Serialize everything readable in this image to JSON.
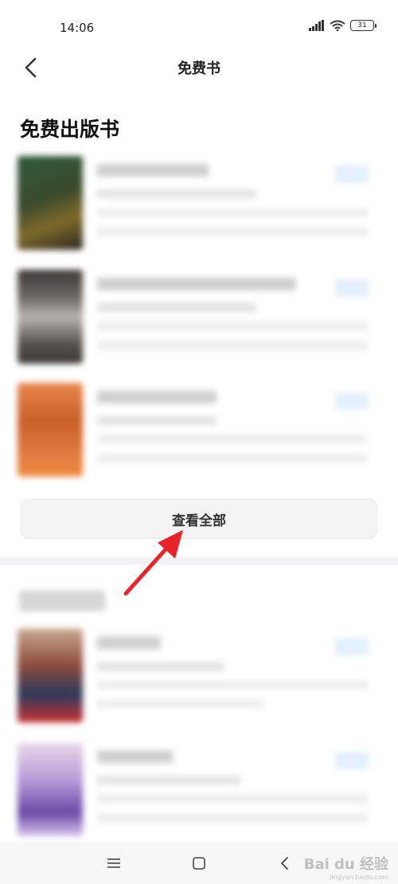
{
  "status_bar": {
    "time": "14:06",
    "battery": "31"
  },
  "nav": {
    "title": "免费书"
  },
  "section1": {
    "title": "免费出版书",
    "books": [
      {
        "cover_color": "#3a4a2a",
        "cover_accent": "#7d6a2a"
      },
      {
        "cover_color": "#4a4643",
        "cover_accent": "#a8a39e"
      },
      {
        "cover_color": "#e07a3f",
        "cover_accent": "#c85f28"
      }
    ],
    "view_all_label": "查看全部"
  },
  "section2": {
    "books": [
      {
        "cover_color": "#8a4a3c",
        "cover_accent": "#2d3a5a"
      },
      {
        "cover_color": "#b79ad8",
        "cover_accent": "#6a4aa8"
      }
    ]
  },
  "watermark": {
    "logo": "Bai du 经验",
    "url": "jingyan.baidu.com"
  },
  "colors": {
    "accent_arrow": "#e8232a",
    "button_bg": "#f4f4f5"
  },
  "icons": [
    "back-arrow-icon",
    "signal-icon",
    "wifi-icon",
    "battery-icon",
    "menu-icon",
    "home-icon",
    "back-icon"
  ]
}
